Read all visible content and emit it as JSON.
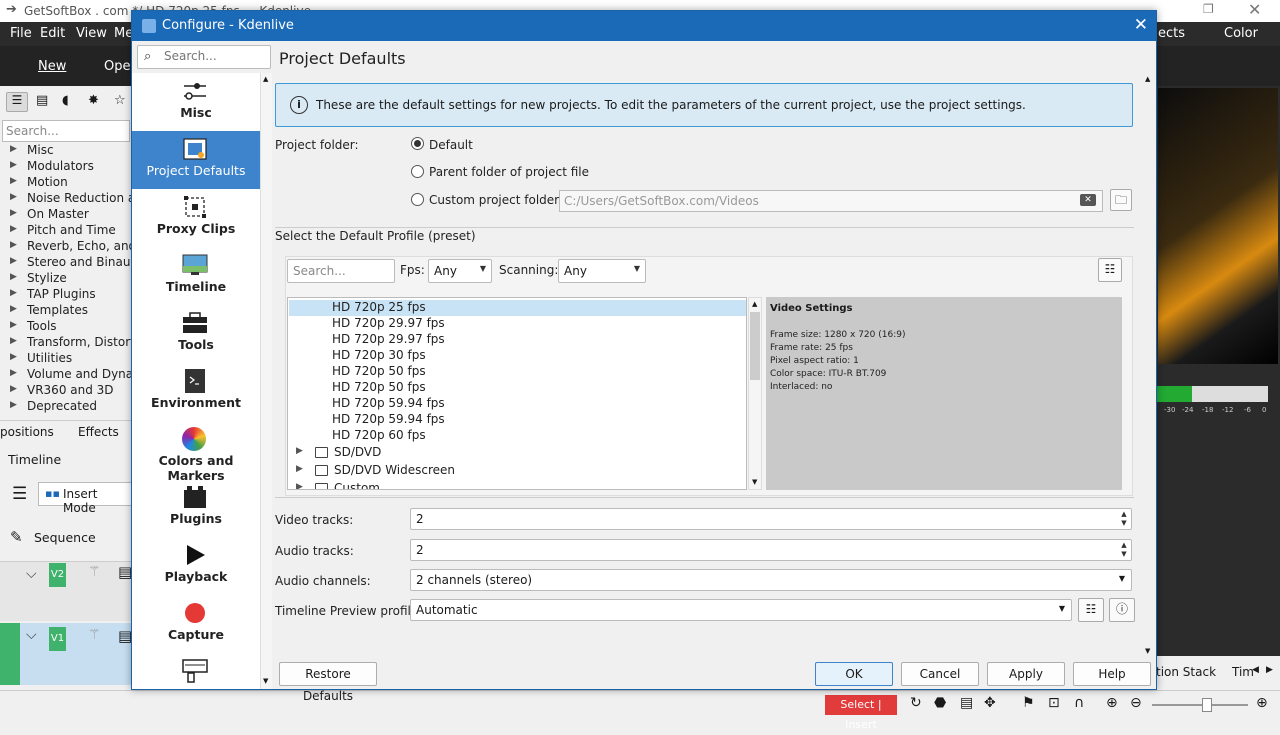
{
  "background": {
    "window_title": "GetSoftBox . com */ HD 720p 25 fps — Kdenlive",
    "menu": [
      "File",
      "Edit",
      "View",
      "Me"
    ],
    "menu_right": [
      "ects",
      "Color"
    ],
    "toolbar": [
      "New",
      "Oper"
    ],
    "left_search_placeholder": "Search...",
    "effect_categories": [
      "Misc",
      "Modulators",
      "Motion",
      "Noise Reduction an",
      "On Master",
      "Pitch and Time",
      "Reverb, Echo, and D",
      "Stereo and Binaural",
      "Stylize",
      "TAP Plugins",
      "Templates",
      "Tools",
      "Transform, Distort, a",
      "Utilities",
      "Volume and Dynam",
      "VR360 and 3D",
      "Deprecated"
    ],
    "bottom_tabs": [
      "positions",
      "Effects"
    ],
    "timeline_label": "Timeline",
    "insert_mode": "Insert Mode",
    "sequence_label": "Sequence",
    "track_v2": "V2",
    "track_v1": "V1",
    "status_select": "Select | Insert",
    "right_tabs": [
      "tion Stack",
      "Tim"
    ],
    "meter_ticks": [
      "-30",
      "-24",
      "-18",
      "-12",
      "-6",
      "0"
    ]
  },
  "dialog": {
    "title": "Configure - Kdenlive",
    "search_placeholder": "Search...",
    "categories": [
      {
        "name": "Misc",
        "icon": "sliders-icon"
      },
      {
        "name": "Project Defaults",
        "icon": "film-icon",
        "selected": true
      },
      {
        "name": "Proxy Clips",
        "icon": "proxy-icon"
      },
      {
        "name": "Timeline",
        "icon": "monitor-icon"
      },
      {
        "name": "Tools",
        "icon": "toolbox-icon"
      },
      {
        "name": "Environment",
        "icon": "terminal-icon"
      },
      {
        "name": "Colors and Markers",
        "icon": "color-wheel-icon"
      },
      {
        "name": "Plugins",
        "icon": "plugin-icon"
      },
      {
        "name": "Playback",
        "icon": "play-icon"
      },
      {
        "name": "Capture",
        "icon": "record-icon"
      }
    ],
    "page_title": "Project Defaults",
    "info_text": "These are the default settings for new projects. To edit the parameters of the current project, use the project settings.",
    "project_folder_label": "Project folder:",
    "radio_default": "Default",
    "radio_parent": "Parent folder of project file",
    "radio_custom": "Custom project folder:",
    "custom_folder_value": "C:/Users/GetSoftBox.com/Videos",
    "profile_section_title": "Select the Default Profile (preset)",
    "profile_search_placeholder": "Search...",
    "fps_label": "Fps:",
    "fps_value": "Any",
    "scanning_label": "Scanning:",
    "scanning_value": "Any",
    "profiles": [
      "HD 720p 25 fps",
      "HD 720p 29.97 fps",
      "HD 720p 29.97 fps",
      "HD 720p 30 fps",
      "HD 720p 50 fps",
      "HD 720p 50 fps",
      "HD 720p 59.94 fps",
      "HD 720p 59.94 fps",
      "HD 720p 60 fps"
    ],
    "folders": [
      "SD/DVD",
      "SD/DVD Widescreen",
      "Custom"
    ],
    "video_settings": {
      "title": "Video Settings",
      "frame_size": "Frame size: 1280 x 720 (16:9)",
      "frame_rate": "Frame rate: 25 fps",
      "pixel_aspect": "Pixel aspect ratio: 1",
      "color_space": "Color space: ITU-R BT.709",
      "interlaced": "Interlaced: no"
    },
    "video_tracks_label": "Video tracks:",
    "video_tracks_value": "2",
    "audio_tracks_label": "Audio tracks:",
    "audio_tracks_value": "2",
    "audio_channels_label": "Audio channels:",
    "audio_channels_value": "2 channels (stereo)",
    "preview_profile_label": "Timeline Preview profile:",
    "preview_profile_value": "Automatic",
    "buttons": {
      "restore": "Restore Defaults",
      "ok": "OK",
      "cancel": "Cancel",
      "apply": "Apply",
      "help": "Help"
    }
  }
}
